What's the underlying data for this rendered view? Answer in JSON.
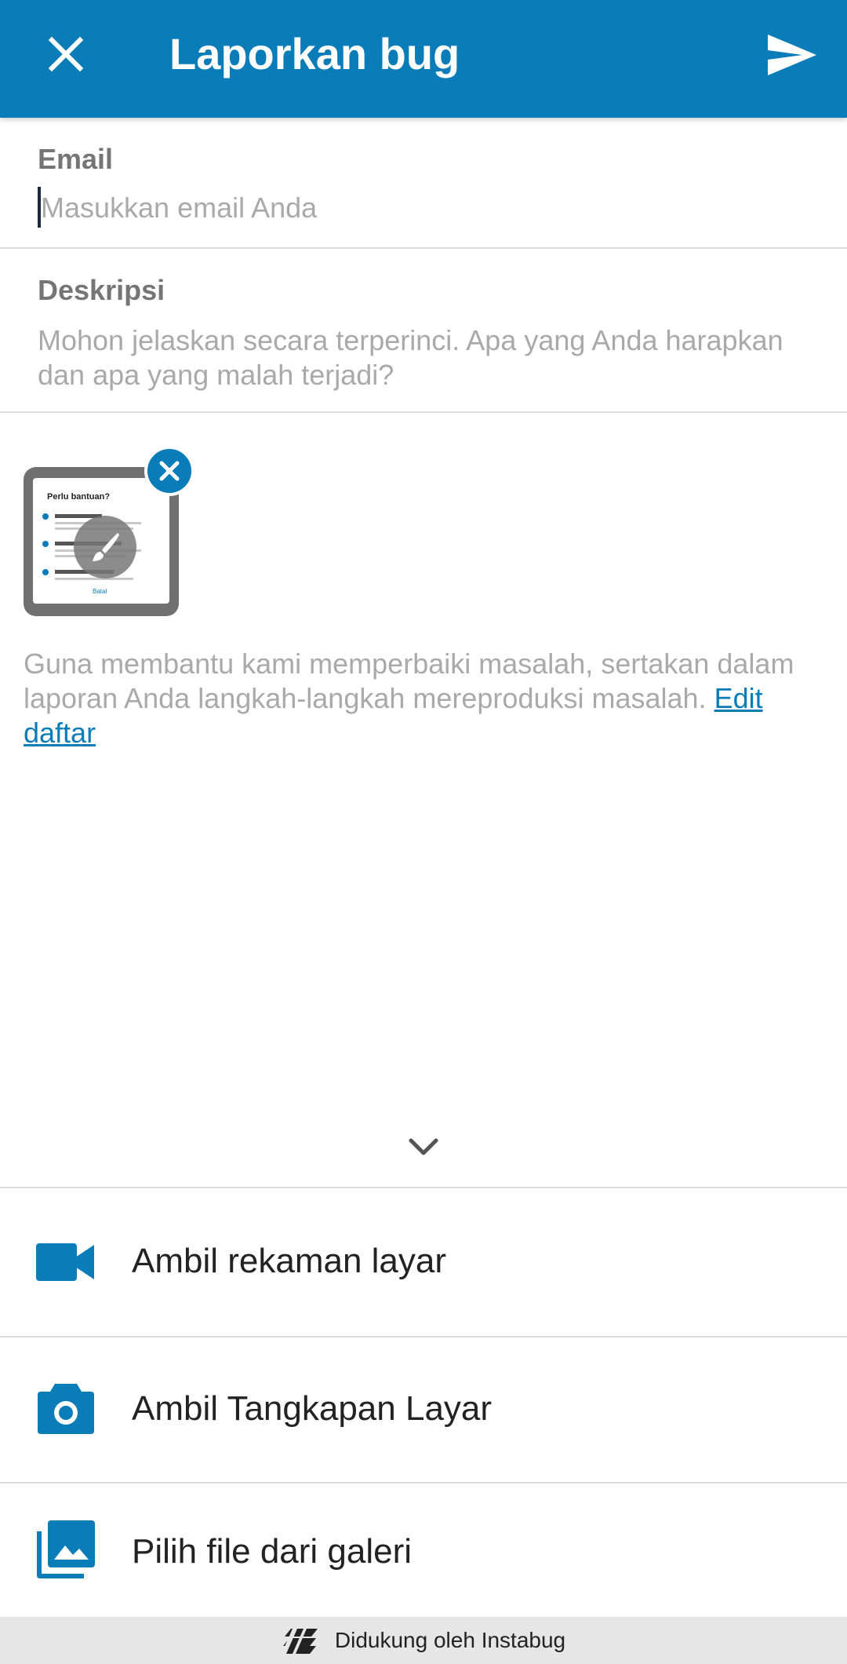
{
  "header": {
    "title": "Laporkan bug",
    "close_icon": "close-icon",
    "send_icon": "send-icon",
    "accent_color": "#0a7cb8"
  },
  "email": {
    "label": "Email",
    "placeholder": "Masukkan email Anda",
    "value": ""
  },
  "description": {
    "label": "Deskripsi",
    "placeholder": "Mohon jelaskan secara terperinci. Apa yang Anda harapkan dan apa yang malah terjadi?"
  },
  "attachment": {
    "thumbnail_title": "Perlu bantuan?",
    "thumbnail_items": [
      "Laporkan bug",
      "Sarankan Perbaikan",
      "Ajukan pertanyaan"
    ],
    "thumbnail_cancel": "Batal",
    "remove_icon": "close-icon",
    "edit_icon": "brush-icon"
  },
  "help": {
    "text": "Guna membantu kami memperbaiki masalah, sertakan dalam laporan Anda langkah-langkah mereproduksi masalah. ",
    "link": "Edit daftar"
  },
  "actions": [
    {
      "label": "Ambil rekaman layar",
      "icon": "video-camera-icon"
    },
    {
      "label": "Ambil Tangkapan Layar",
      "icon": "camera-icon"
    },
    {
      "label": "Pilih file dari galeri",
      "icon": "gallery-icon"
    }
  ],
  "footer": {
    "text": "Didukung oleh Instabug",
    "logo_icon": "instabug-logo-icon"
  }
}
